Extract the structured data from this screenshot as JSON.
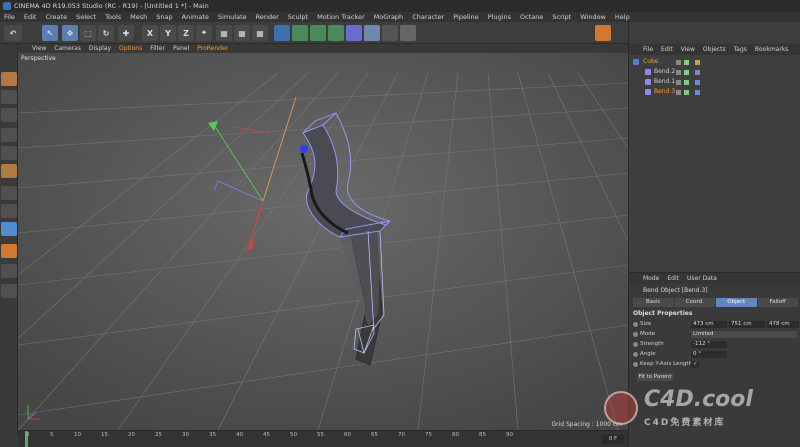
{
  "window": {
    "title": "CINEMA 4D R19.053 Studio (RC - R19) - [Untitled 1 *] - Main"
  },
  "menubar": {
    "items": [
      "File",
      "Edit",
      "Create",
      "Select",
      "Tools",
      "Mesh",
      "Snap",
      "Animate",
      "Simulate",
      "Render",
      "Sculpt",
      "Motion Tracker",
      "MoGraph",
      "Character",
      "Pipeline",
      "Plugins",
      "Octane",
      "Script",
      "Window",
      "Help"
    ]
  },
  "toolbar": {
    "axis_x": "X",
    "axis_y": "Y",
    "axis_z": "Z"
  },
  "viewport": {
    "menu": [
      "View",
      "Cameras",
      "Display",
      "Options",
      "Filter",
      "Panel",
      "ProRender"
    ],
    "label": "Perspective",
    "grid_spacing": "Grid Spacing : 1000 cm"
  },
  "timeline": {
    "ticks": [
      "0",
      "5",
      "10",
      "15",
      "20",
      "25",
      "30",
      "35",
      "40",
      "45",
      "50",
      "55",
      "60",
      "65",
      "70",
      "75",
      "80",
      "85",
      "90"
    ],
    "frame": "0 F"
  },
  "objects": {
    "menu": [
      "File",
      "Edit",
      "View",
      "Objects",
      "Tags",
      "Bookmarks"
    ],
    "items": [
      {
        "name": "Cube",
        "selected": true
      },
      {
        "name": "Bend.2",
        "selected": false
      },
      {
        "name": "Bend.1",
        "selected": false
      },
      {
        "name": "Bend.3",
        "selected": true
      }
    ]
  },
  "attributes": {
    "menu": [
      "Mode",
      "Edit",
      "User Data"
    ],
    "title": "Bend Object [Bend.3]",
    "tabs": [
      "Basic",
      "Coord.",
      "Object",
      "Falloff"
    ],
    "active_tab": "Object",
    "section": "Object Properties",
    "size_label": "Size",
    "size_x": "473 cm",
    "size_y": "751 cm",
    "size_z": "478 cm",
    "mode_label": "Mode",
    "mode_value": "Limited",
    "strength_label": "Strength",
    "strength_value": "-112 °",
    "angle_label": "Angle",
    "angle_value": "0 °",
    "keep_label": "Keep Y-Axis Length",
    "keep_value": "✓",
    "fit_button": "Fit to Parent"
  },
  "watermark": {
    "main": "C4D.cool",
    "sub": "C4D免费素材库"
  }
}
